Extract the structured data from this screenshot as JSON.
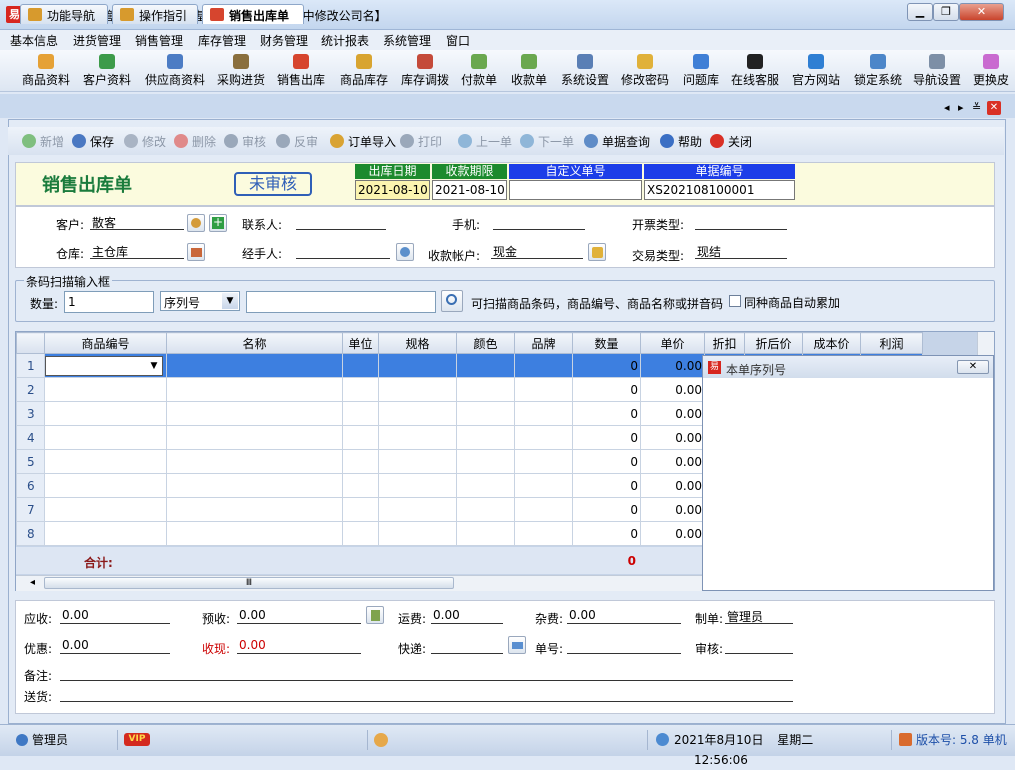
{
  "window": {
    "app_icon_text": "易",
    "title": "易特手机销售管理软件--【请在基本信息，公司信息中修改公司名】",
    "btn_min": "▁",
    "btn_max": "❐",
    "btn_close": "✕"
  },
  "menu": [
    "基本信息",
    "进货管理",
    "销售管理",
    "库存管理",
    "财务管理",
    "统计报表",
    "系统管理",
    "窗口"
  ],
  "toolbar": [
    {
      "label": "商品资料",
      "icon": "goods-icon",
      "color": "#e5a136"
    },
    {
      "label": "客户资料",
      "icon": "customer-icon",
      "color": "#3d9b4a"
    },
    {
      "label": "供应商资料",
      "icon": "supplier-icon",
      "color": "#4c7cc4"
    },
    {
      "label": "采购进货",
      "icon": "purchase-icon",
      "color": "#8a6f3d"
    },
    {
      "label": "销售出库",
      "icon": "sales-out-icon",
      "color": "#d6452e"
    },
    {
      "label": "商品库存",
      "icon": "stock-icon",
      "color": "#d8a430"
    },
    {
      "label": "库存调拨",
      "icon": "transfer-icon",
      "color": "#c44a3a"
    },
    {
      "label": "付款单",
      "icon": "payment-icon",
      "color": "#6aa84f"
    },
    {
      "label": "收款单",
      "icon": "receipt-icon",
      "color": "#6aa84f"
    },
    {
      "label": "系统设置",
      "icon": "settings-icon",
      "color": "#5a7fb5"
    },
    {
      "label": "修改密码",
      "icon": "password-icon",
      "color": "#e0b13a"
    },
    {
      "label": "问题库",
      "icon": "faq-icon",
      "color": "#3f7fd6"
    },
    {
      "label": "在线客服",
      "icon": "qq-icon",
      "color": "#222222"
    },
    {
      "label": "官方网站",
      "icon": "ie-icon",
      "color": "#2f7fd3"
    },
    {
      "label": "锁定系统",
      "icon": "lock-icon",
      "color": "#4c86c9"
    },
    {
      "label": "导航设置",
      "icon": "nav-settings-icon",
      "color": "#7d8fa6"
    },
    {
      "label": "更换皮",
      "icon": "skin-icon",
      "color": "#c96bd0"
    }
  ],
  "tabs": [
    {
      "label": "功能导航",
      "active": false
    },
    {
      "label": "操作指引",
      "active": false
    },
    {
      "label": "销售出库单",
      "active": true
    }
  ],
  "tab_nav": {
    "prev": "◂",
    "next": "▸",
    "menu": "≚",
    "close": "✕"
  },
  "actions": [
    {
      "label": "新增",
      "enabled": false,
      "color": "#7fbf7f"
    },
    {
      "label": "保存",
      "enabled": true,
      "color": "#4a78c2"
    },
    {
      "label": "修改",
      "enabled": false,
      "color": "#a9b4c4"
    },
    {
      "label": "删除",
      "enabled": false,
      "color": "#e08a8a"
    },
    {
      "label": "审核",
      "enabled": false,
      "color": "#9aa8ba"
    },
    {
      "label": "反审",
      "enabled": false,
      "color": "#9aa8ba"
    },
    {
      "label": "订单导入",
      "enabled": true,
      "color": "#d9a333"
    },
    {
      "label": "打印",
      "enabled": false,
      "color": "#9aa8ba"
    },
    {
      "label": "上一单",
      "enabled": false,
      "color": "#8fb6d8"
    },
    {
      "label": "下一单",
      "enabled": false,
      "color": "#8fb6d8"
    },
    {
      "label": "单据查询",
      "enabled": true,
      "color": "#5f8cc7"
    },
    {
      "label": "帮助",
      "enabled": true,
      "color": "#3b6fc4"
    },
    {
      "label": "关闭",
      "enabled": true,
      "color": "#d93025"
    }
  ],
  "form": {
    "title": "销售出库单",
    "status": "未审核",
    "out_date_label": "出库日期",
    "out_date": "2021-08-10",
    "due_date_label": "收款期限",
    "due_date": "2021-08-10",
    "custom_no_label": "自定义单号",
    "custom_no": "",
    "doc_no_label": "单据编号",
    "doc_no": "XS202108100001",
    "label_green": "#1c8a2d",
    "label_blue": "#1d3ee8"
  },
  "info": {
    "customer_label": "客户:",
    "customer": "散客",
    "contact_label": "联系人:",
    "contact": "",
    "mobile_label": "手机:",
    "mobile": "",
    "invoice_type_label": "开票类型:",
    "invoice_type": "",
    "warehouse_label": "仓库:",
    "warehouse": "主仓库",
    "handler_label": "经手人:",
    "handler": "",
    "account_label": "收款帐户:",
    "account": "现金",
    "trade_type_label": "交易类型:",
    "trade_type": "现结"
  },
  "scan": {
    "legend": "条码扫描输入框",
    "qty_label": "数量:",
    "qty": "1",
    "mode": "序列号",
    "input": "",
    "hint": "可扫描商品条码，商品编号、商品名称或拼音码",
    "accumulate_label": "同种商品自动累加"
  },
  "grid": {
    "columns": [
      "商品编号",
      "名称",
      "单位",
      "规格",
      "颜色",
      "品牌",
      "数量",
      "单价",
      "折扣",
      "折后价",
      "成本价",
      "利润"
    ],
    "rows": [
      {
        "no": "1",
        "qty": "0",
        "price": "0.00"
      },
      {
        "no": "2",
        "qty": "0",
        "price": "0.00"
      },
      {
        "no": "3",
        "qty": "0",
        "price": "0.00"
      },
      {
        "no": "4",
        "qty": "0",
        "price": "0.00"
      },
      {
        "no": "5",
        "qty": "0",
        "price": "0.00"
      },
      {
        "no": "6",
        "qty": "0",
        "price": "0.00"
      },
      {
        "no": "7",
        "qty": "0",
        "price": "0.00"
      },
      {
        "no": "8",
        "qty": "0",
        "price": "0.00"
      }
    ],
    "total_label": "合计:",
    "total_qty": "0",
    "scroll_left": "◂",
    "scroll_grip": "Ⅲ"
  },
  "popup": {
    "title": "本单序列号",
    "close": "✕"
  },
  "bottom": {
    "receivable_label": "应收:",
    "receivable": "0.00",
    "prepaid_label": "预收:",
    "prepaid": "0.00",
    "freight_label": "运费:",
    "freight": "0.00",
    "misc_label": "杂费:",
    "misc": "0.00",
    "maker_label": "制单:",
    "maker": "管理员",
    "discount_label": "优惠:",
    "discount": "0.00",
    "cash_label": "收现:",
    "cash": "0.00",
    "express_label": "快递:",
    "express": "",
    "ship_no_label": "单号:",
    "ship_no": "",
    "auditor_label": "审核:",
    "auditor": "",
    "remark_label": "备注:",
    "remark": "",
    "delivery_label": "送货:",
    "delivery": ""
  },
  "statusbar": {
    "user": "管理员",
    "vip": "VIP",
    "date": "2021年8月10日",
    "weekday": "星期二",
    "time": "12:56:06",
    "version": "版本号: 5.8 单机"
  }
}
